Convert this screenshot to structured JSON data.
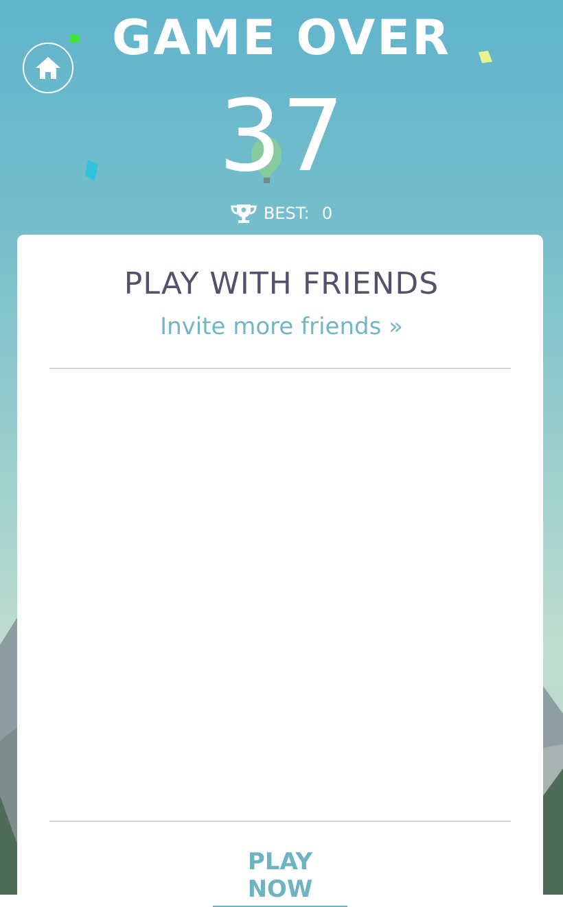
{
  "header": {
    "title": "GAME OVER",
    "score": "37",
    "best_label": "BEST:",
    "best_value": "0"
  },
  "card": {
    "title": "PLAY WITH FRIENDS",
    "invite_label": "Invite more friends »",
    "play_now_label": "PLAY NOW"
  },
  "icons": {
    "home": "home-icon",
    "trophy": "trophy-icon",
    "balloon": "hot-air-balloon-icon"
  },
  "colors": {
    "sky_top": "#5fb4cb",
    "card_title": "#55506c",
    "accent": "#6eb3c1"
  }
}
